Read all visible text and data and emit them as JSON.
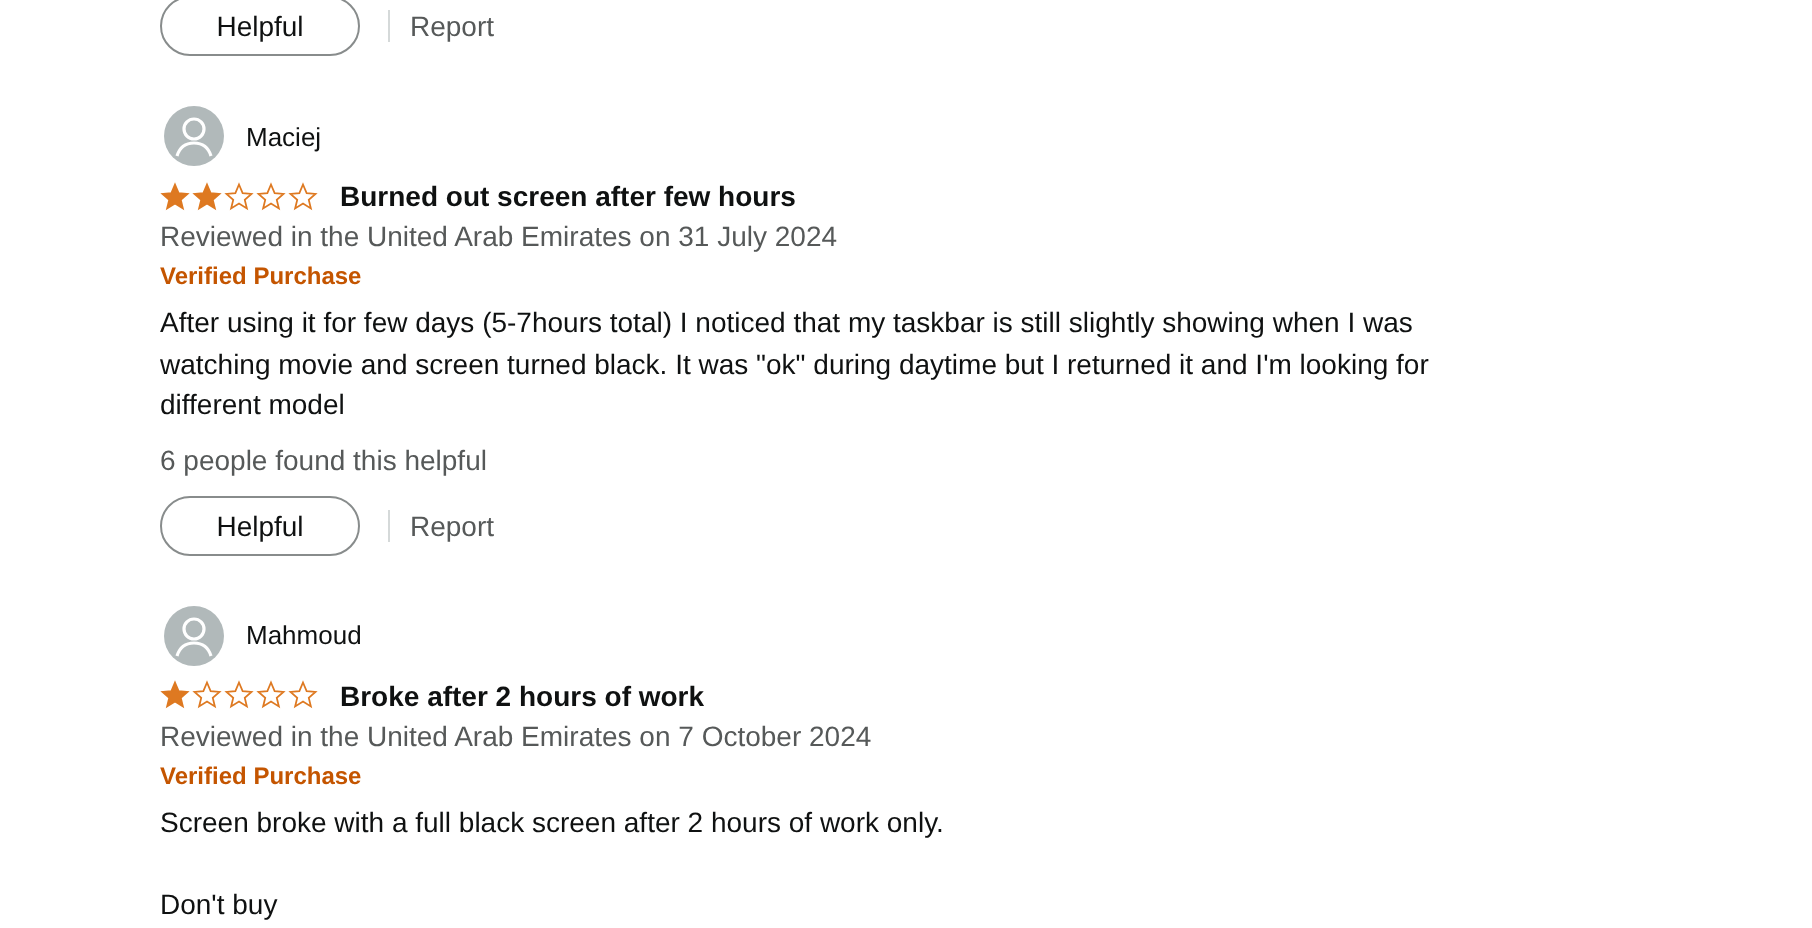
{
  "top_actions": {
    "helpful_button": "Helpful",
    "report_link": "Report"
  },
  "reviews": [
    {
      "name": "Maciej",
      "stars": 2,
      "title": "Burned out screen after few hours",
      "meta": "Reviewed in the United Arab Emirates on 31 July 2024",
      "badge": "Verified Purchase",
      "paragraphs": [
        "After using it for few days (5-7hours total) I noticed that my taskbar is still slightly showing when I was watching movie and screen turned black. It was \"ok\" during daytime but I returned it and I'm looking for different model"
      ],
      "helpful_count": "6 people found this helpful",
      "helpful_button": "Helpful",
      "report_link": "Report"
    },
    {
      "name": "Mahmoud",
      "stars": 1,
      "title": "Broke after 2 hours of work",
      "meta": "Reviewed in the United Arab Emirates on 7 October 2024",
      "badge": "Verified Purchase",
      "paragraphs": [
        "Screen broke with a full black screen after 2 hours of work only.",
        "Don't buy"
      ]
    }
  ]
}
